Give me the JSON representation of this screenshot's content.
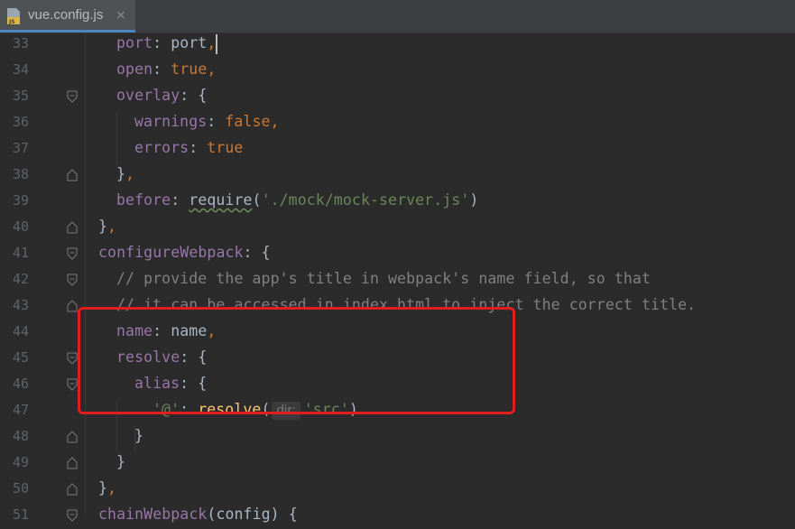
{
  "tab": {
    "label": "vue.config.js",
    "icon": "js-file-icon",
    "close": "×"
  },
  "editor": {
    "lines": [
      {
        "num": "33",
        "k": "port",
        "rest": ": port,",
        "fold": ""
      },
      {
        "num": "34",
        "k": "open",
        "val": "true",
        "fold": ""
      },
      {
        "num": "35",
        "k": "overlay",
        "fold": "open"
      },
      {
        "num": "36",
        "k": "warnings",
        "val": "false",
        "fold": ""
      },
      {
        "num": "37",
        "k": "errors",
        "val": "true",
        "fold": ""
      },
      {
        "num": "38",
        "text": "},",
        "fold": "close"
      },
      {
        "num": "39",
        "k": "before",
        "fn": "require",
        "str": "'./mock/mock-server.js'",
        "fold": ""
      },
      {
        "num": "40",
        "text": "},",
        "fold": "close"
      },
      {
        "num": "41",
        "k": "configureWebpack",
        "fold": "open"
      },
      {
        "num": "42",
        "comment": "// provide the app's title in webpack's name field, so that",
        "fold": "open"
      },
      {
        "num": "43",
        "comment": "// it can be accessed in index.html to inject the correct title.",
        "fold": "close"
      },
      {
        "num": "44",
        "k": "name",
        "val": "name",
        "fold": ""
      },
      {
        "num": "45",
        "k": "resolve",
        "fold": "open"
      },
      {
        "num": "46",
        "k": "alias",
        "fold": "open"
      },
      {
        "num": "47",
        "str": "'@'",
        "fn": "resolve",
        "hint": "dir:",
        "arg": "'src'",
        "fold": ""
      },
      {
        "num": "48",
        "text": "}",
        "fold": "close"
      },
      {
        "num": "49",
        "text": "}",
        "fold": "close"
      },
      {
        "num": "50",
        "text": "},",
        "fold": "close"
      },
      {
        "num": "51",
        "k": "chainWebpack",
        "text": "(config) {",
        "fold": "open"
      }
    ]
  },
  "colors": {
    "highlight": "#e21d1d",
    "background": "#2b2b2b"
  }
}
